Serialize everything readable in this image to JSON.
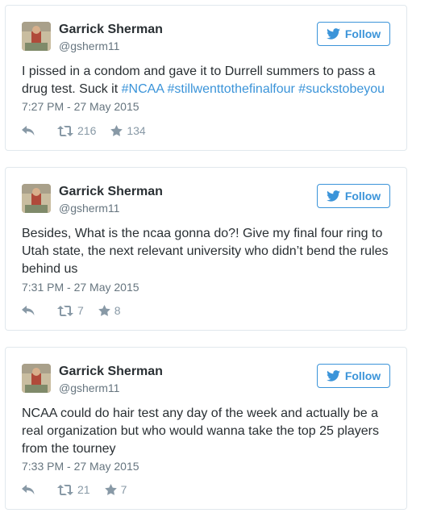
{
  "follow_label": "Follow",
  "colors": {
    "link": "#3b94d9",
    "text": "#292f33",
    "muted": "#66757f",
    "icon": "#8899a6",
    "border": "#e1e8ed"
  },
  "icons": {
    "reply": "reply-icon",
    "retweet": "retweet-icon",
    "like": "star-icon",
    "follow": "twitter-bird-icon"
  },
  "tweets": [
    {
      "author": "Garrick Sherman",
      "handle": "@gsherm11",
      "text_plain": "I pissed in a condom and gave it to Durrell summers to pass a drug test. Suck it ",
      "hashtags": [
        "#NCAA",
        "#stillwenttothefinalfour",
        "#suckstobeyou"
      ],
      "timestamp": "7:27 PM - 27 May 2015",
      "retweets": "216",
      "likes": "134"
    },
    {
      "author": "Garrick Sherman",
      "handle": "@gsherm11",
      "text_plain": "Besides, What is the ncaa gonna do?! Give my final four ring to Utah state, the next relevant university who didn’t bend the rules behind us",
      "timestamp": "7:31 PM - 27 May 2015",
      "retweets": "7",
      "likes": "8"
    },
    {
      "author": "Garrick Sherman",
      "handle": "@gsherm11",
      "text_plain": "NCAA could do hair test any day of the week and actually be a real organization but who would wanna take the top 25 players from the tourney",
      "timestamp": "7:33 PM - 27 May 2015",
      "retweets": "21",
      "likes": "7"
    }
  ]
}
